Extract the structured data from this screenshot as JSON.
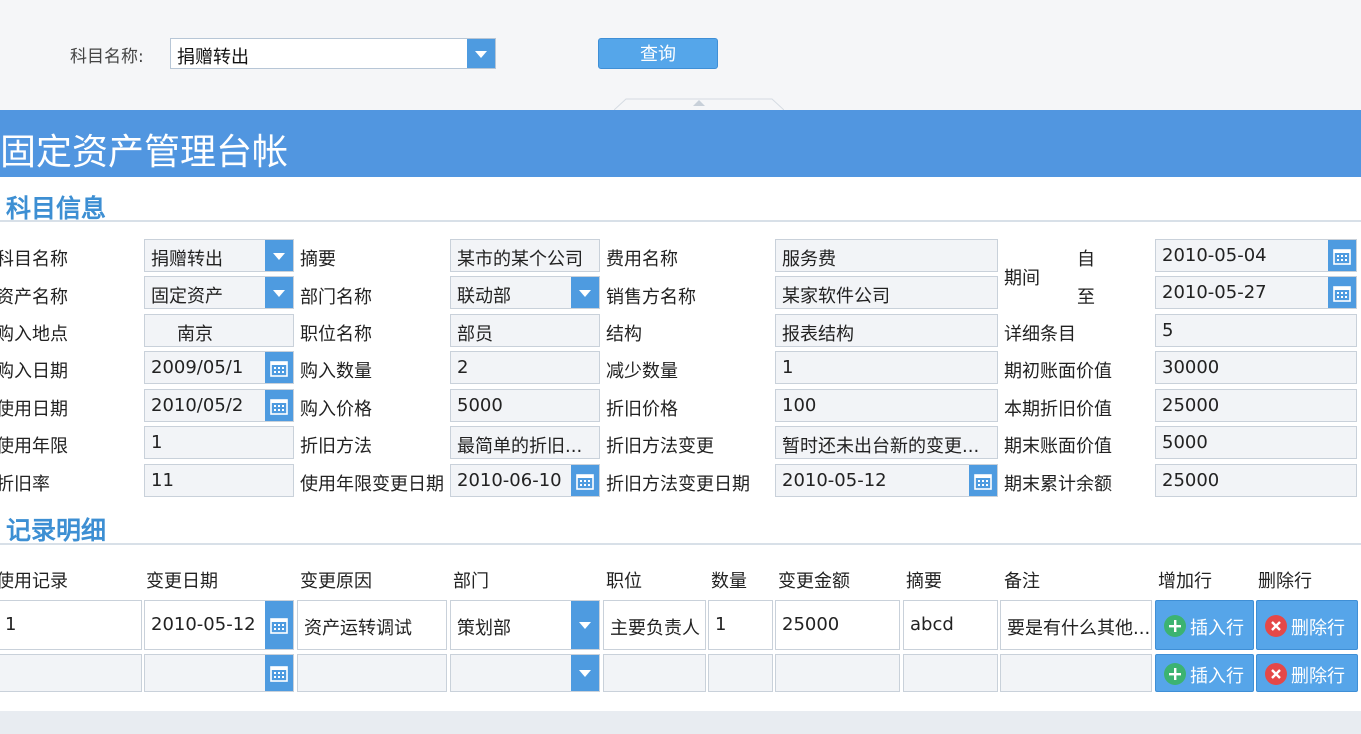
{
  "query": {
    "label": "科目名称:",
    "value": "捐赠转出",
    "button": "查询"
  },
  "banner": {
    "title": "固定资产管理台帐"
  },
  "subject_info": {
    "title": "科目信息",
    "fields": {
      "subject_name": {
        "label": "科目名称",
        "value": "捐赠转出"
      },
      "asset_name": {
        "label": "资产名称",
        "value": "固定资产"
      },
      "purchase_place": {
        "label": "购入地点",
        "value": "南京"
      },
      "purchase_date": {
        "label": "购入日期",
        "value": "2009/05/1"
      },
      "use_date": {
        "label": "使用日期",
        "value": "2010/05/2"
      },
      "use_years": {
        "label": "使用年限",
        "value": "1"
      },
      "depr_rate": {
        "label": "折旧率",
        "value": "11"
      },
      "summary": {
        "label": "摘要",
        "value": "某市的某个公司"
      },
      "dept_name": {
        "label": "部门名称",
        "value": "联动部"
      },
      "position_name": {
        "label": "职位名称",
        "value": "部员"
      },
      "purchase_qty": {
        "label": "购入数量",
        "value": "2"
      },
      "purchase_price": {
        "label": "购入价格",
        "value": "5000"
      },
      "depr_method": {
        "label": "折旧方法",
        "value": "最简单的折旧..."
      },
      "use_years_change_date": {
        "label": "使用年限变更日期",
        "value": "2010-06-10"
      },
      "expense_name": {
        "label": "费用名称",
        "value": "服务费"
      },
      "seller_name": {
        "label": "销售方名称",
        "value": "某家软件公司"
      },
      "structure": {
        "label": "结构",
        "value": "报表结构"
      },
      "reduce_qty": {
        "label": "减少数量",
        "value": "1"
      },
      "depr_price": {
        "label": "折旧价格",
        "value": "100"
      },
      "depr_method_change": {
        "label": "折旧方法变更",
        "value": "暂时还未出台新的变更..."
      },
      "depr_method_change_date": {
        "label": "折旧方法变更日期",
        "value": "2010-05-12"
      },
      "period": {
        "label": "期间",
        "from_label": "自",
        "from": "2010-05-04",
        "to_label": "至",
        "to": "2010-05-27"
      },
      "detail_items": {
        "label": "详细条目",
        "value": "5"
      },
      "opening_book_value": {
        "label": "期初账面价值",
        "value": "30000"
      },
      "current_depr_value": {
        "label": "本期折旧价值",
        "value": "25000"
      },
      "closing_book_value": {
        "label": "期末账面价值",
        "value": "5000"
      },
      "closing_balance": {
        "label": "期末累计余额",
        "value": "25000"
      }
    }
  },
  "records": {
    "title": "记录明细",
    "columns": [
      "使用记录",
      "变更日期",
      "变更原因",
      "部门",
      "职位",
      "数量",
      "变更金额",
      "摘要",
      "备注",
      "增加行",
      "删除行"
    ],
    "rows": [
      {
        "record": "1",
        "date": "2010-05-12",
        "reason": "资产运转调试",
        "dept": "策划部",
        "position": "主要负责人",
        "qty": "1",
        "amount": "25000",
        "summary": "abcd",
        "remark": "要是有什么其他...",
        "insert": "插入行",
        "delete": "删除行"
      },
      {
        "record": "",
        "date": "",
        "reason": "",
        "dept": "",
        "position": "",
        "qty": "",
        "amount": "",
        "summary": "",
        "remark": "",
        "insert": "插入行",
        "delete": "删除行"
      }
    ]
  },
  "colors": {
    "accent": "#5196e0",
    "button": "#56a5e9",
    "title": "#3d8fd3",
    "add": "#3cb371",
    "remove": "#e54848"
  }
}
